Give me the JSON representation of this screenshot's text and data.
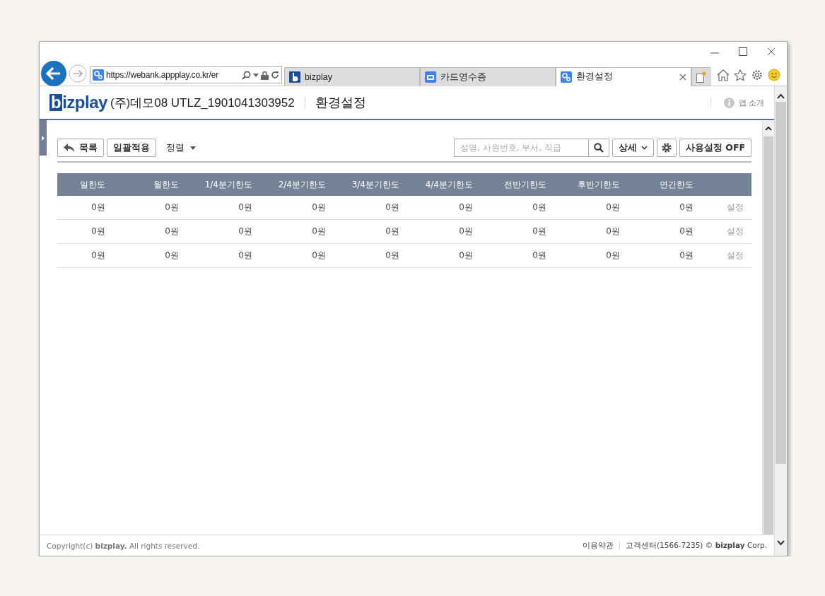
{
  "browser": {
    "address": "https://webank.appplay.co.kr/er",
    "tabs": [
      {
        "label": "bizplay",
        "selected": false
      },
      {
        "label": "카드영수증",
        "selected": false
      },
      {
        "label": "환경설정",
        "selected": true
      }
    ]
  },
  "header": {
    "logo_mark": "b",
    "logo_text": "izplay",
    "company": "(주)데모08 UTLZ_1901041303952",
    "title": "환경설정",
    "app_intro": "앱 소개"
  },
  "toolbar": {
    "back_button": "목록",
    "apply_button": "일괄적용",
    "sort": "정렬",
    "search": {
      "placeholder": "성명, 사원번호, 부서, 직급"
    },
    "detail_button": "상세",
    "usage_button": "사용설정 OFF"
  },
  "table": {
    "columns": [
      "일한도",
      "월한도",
      "1/4분기한도",
      "2/4분기한도",
      "3/4분기한도",
      "4/4분기한도",
      "전반기한도",
      "후반기한도",
      "연간한도"
    ],
    "rows": [
      {
        "cells": [
          "0원",
          "0원",
          "0원",
          "0원",
          "0원",
          "0원",
          "0원",
          "0원",
          "0원"
        ],
        "action": "설정"
      },
      {
        "cells": [
          "0원",
          "0원",
          "0원",
          "0원",
          "0원",
          "0원",
          "0원",
          "0원",
          "0원"
        ],
        "action": "설정"
      },
      {
        "cells": [
          "0원",
          "0원",
          "0원",
          "0원",
          "0원",
          "0원",
          "0원",
          "0원",
          "0원"
        ],
        "action": "설정"
      }
    ]
  },
  "footer": {
    "copyright": "Copyright(c) **bizplay.** All rights reserved.",
    "terms": "이용약관",
    "support": "고객센터(1566-7235) © **bizplay** Corp."
  }
}
